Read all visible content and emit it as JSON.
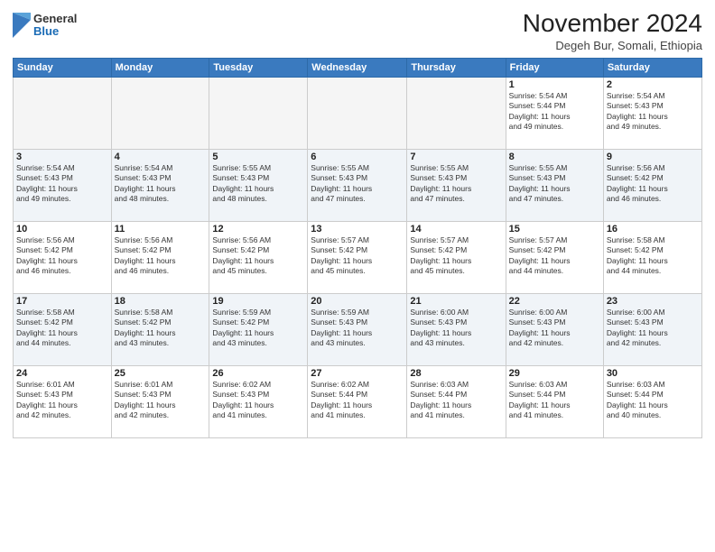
{
  "header": {
    "logo": {
      "general": "General",
      "blue": "Blue"
    },
    "month_title": "November 2024",
    "location": "Degeh Bur, Somali, Ethiopia"
  },
  "weekdays": [
    "Sunday",
    "Monday",
    "Tuesday",
    "Wednesday",
    "Thursday",
    "Friday",
    "Saturday"
  ],
  "weeks": [
    [
      {
        "day": "",
        "empty": true
      },
      {
        "day": "",
        "empty": true
      },
      {
        "day": "",
        "empty": true
      },
      {
        "day": "",
        "empty": true
      },
      {
        "day": "",
        "empty": true
      },
      {
        "day": "1",
        "sunrise": "5:54 AM",
        "sunset": "5:44 PM",
        "daylight": "11 hours and 49 minutes."
      },
      {
        "day": "2",
        "sunrise": "5:54 AM",
        "sunset": "5:43 PM",
        "daylight": "11 hours and 49 minutes."
      }
    ],
    [
      {
        "day": "3",
        "sunrise": "5:54 AM",
        "sunset": "5:43 PM",
        "daylight": "11 hours and 49 minutes."
      },
      {
        "day": "4",
        "sunrise": "5:54 AM",
        "sunset": "5:43 PM",
        "daylight": "11 hours and 48 minutes."
      },
      {
        "day": "5",
        "sunrise": "5:55 AM",
        "sunset": "5:43 PM",
        "daylight": "11 hours and 48 minutes."
      },
      {
        "day": "6",
        "sunrise": "5:55 AM",
        "sunset": "5:43 PM",
        "daylight": "11 hours and 47 minutes."
      },
      {
        "day": "7",
        "sunrise": "5:55 AM",
        "sunset": "5:43 PM",
        "daylight": "11 hours and 47 minutes."
      },
      {
        "day": "8",
        "sunrise": "5:55 AM",
        "sunset": "5:43 PM",
        "daylight": "11 hours and 47 minutes."
      },
      {
        "day": "9",
        "sunrise": "5:56 AM",
        "sunset": "5:42 PM",
        "daylight": "11 hours and 46 minutes."
      }
    ],
    [
      {
        "day": "10",
        "sunrise": "5:56 AM",
        "sunset": "5:42 PM",
        "daylight": "11 hours and 46 minutes."
      },
      {
        "day": "11",
        "sunrise": "5:56 AM",
        "sunset": "5:42 PM",
        "daylight": "11 hours and 46 minutes."
      },
      {
        "day": "12",
        "sunrise": "5:56 AM",
        "sunset": "5:42 PM",
        "daylight": "11 hours and 45 minutes."
      },
      {
        "day": "13",
        "sunrise": "5:57 AM",
        "sunset": "5:42 PM",
        "daylight": "11 hours and 45 minutes."
      },
      {
        "day": "14",
        "sunrise": "5:57 AM",
        "sunset": "5:42 PM",
        "daylight": "11 hours and 45 minutes."
      },
      {
        "day": "15",
        "sunrise": "5:57 AM",
        "sunset": "5:42 PM",
        "daylight": "11 hours and 44 minutes."
      },
      {
        "day": "16",
        "sunrise": "5:58 AM",
        "sunset": "5:42 PM",
        "daylight": "11 hours and 44 minutes."
      }
    ],
    [
      {
        "day": "17",
        "sunrise": "5:58 AM",
        "sunset": "5:42 PM",
        "daylight": "11 hours and 44 minutes."
      },
      {
        "day": "18",
        "sunrise": "5:58 AM",
        "sunset": "5:42 PM",
        "daylight": "11 hours and 43 minutes."
      },
      {
        "day": "19",
        "sunrise": "5:59 AM",
        "sunset": "5:42 PM",
        "daylight": "11 hours and 43 minutes."
      },
      {
        "day": "20",
        "sunrise": "5:59 AM",
        "sunset": "5:43 PM",
        "daylight": "11 hours and 43 minutes."
      },
      {
        "day": "21",
        "sunrise": "6:00 AM",
        "sunset": "5:43 PM",
        "daylight": "11 hours and 43 minutes."
      },
      {
        "day": "22",
        "sunrise": "6:00 AM",
        "sunset": "5:43 PM",
        "daylight": "11 hours and 42 minutes."
      },
      {
        "day": "23",
        "sunrise": "6:00 AM",
        "sunset": "5:43 PM",
        "daylight": "11 hours and 42 minutes."
      }
    ],
    [
      {
        "day": "24",
        "sunrise": "6:01 AM",
        "sunset": "5:43 PM",
        "daylight": "11 hours and 42 minutes."
      },
      {
        "day": "25",
        "sunrise": "6:01 AM",
        "sunset": "5:43 PM",
        "daylight": "11 hours and 42 minutes."
      },
      {
        "day": "26",
        "sunrise": "6:02 AM",
        "sunset": "5:43 PM",
        "daylight": "11 hours and 41 minutes."
      },
      {
        "day": "27",
        "sunrise": "6:02 AM",
        "sunset": "5:44 PM",
        "daylight": "11 hours and 41 minutes."
      },
      {
        "day": "28",
        "sunrise": "6:03 AM",
        "sunset": "5:44 PM",
        "daylight": "11 hours and 41 minutes."
      },
      {
        "day": "29",
        "sunrise": "6:03 AM",
        "sunset": "5:44 PM",
        "daylight": "11 hours and 41 minutes."
      },
      {
        "day": "30",
        "sunrise": "6:03 AM",
        "sunset": "5:44 PM",
        "daylight": "11 hours and 40 minutes."
      }
    ]
  ],
  "labels": {
    "sunrise": "Sunrise:",
    "sunset": "Sunset:",
    "daylight": "Daylight:"
  }
}
